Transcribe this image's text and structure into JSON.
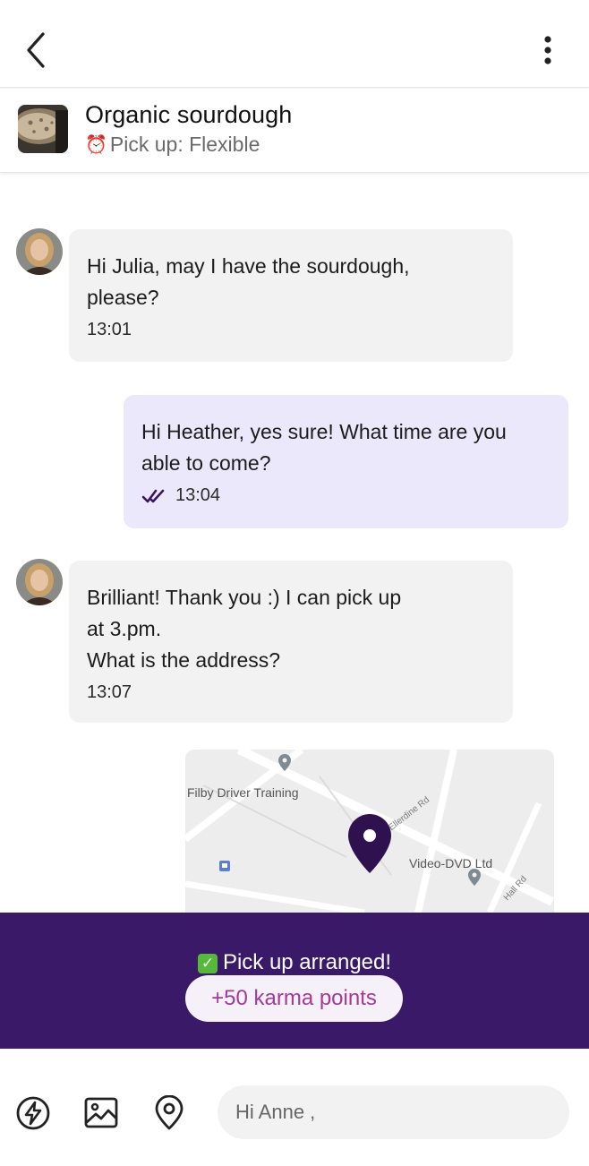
{
  "listing": {
    "title": "Organic sourdough",
    "pickup_icon": "alarm-clock-emoji",
    "pickup_text": "Pick up: Flexible"
  },
  "messages": [
    {
      "direction": "incoming",
      "text_lines": [
        "Hi Julia, may I have the sourdough,",
        "please?"
      ],
      "time": "13:01"
    },
    {
      "direction": "outgoing",
      "text_lines": [
        "Hi Heather, yes sure! What time are you",
        "able to come?"
      ],
      "time": "13:04",
      "status": "read"
    },
    {
      "direction": "incoming",
      "text_lines": [
        "Brilliant! Thank you :) I can pick up",
        "at 3.pm.",
        "What is the address?"
      ],
      "time": "13:07"
    }
  ],
  "map": {
    "labels": [
      "Filby Driver Training",
      "Ellerdine Rd",
      "Video-DVD Ltd",
      "Hall Rd"
    ]
  },
  "banner": {
    "text": "Pick up arranged!",
    "karma": "+50 karma points"
  },
  "composer": {
    "placeholder": "Hi Anne ,",
    "icons": [
      "quick-reply-icon",
      "image-icon",
      "location-icon"
    ]
  },
  "colors": {
    "banner_bg": "#3a1a68",
    "outgoing_bubble": "#ebe8fb",
    "incoming_bubble": "#f2f2f2",
    "accent": "#3b1466",
    "karma_text": "#a23a9a"
  }
}
